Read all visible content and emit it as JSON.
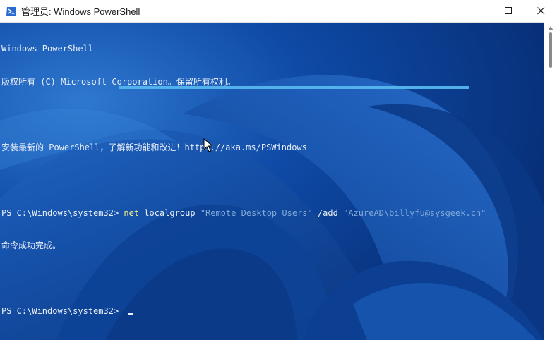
{
  "window": {
    "title": "管理员: Windows PowerShell",
    "accent": "#0b3e8e",
    "controls": [
      "minimize",
      "maximize",
      "close"
    ]
  },
  "console": {
    "banner_title": "Windows PowerShell",
    "copyright": "版权所有 (C) Microsoft Corporation。保留所有权利。",
    "install_tip": "安装最新的 PowerShell，了解新功能和改进！https://aka.ms/PSWindows",
    "prompt1": "PS C:\\Windows\\system32> ",
    "command": {
      "keyword": "net",
      "args": " localgroup ",
      "group": "\"Remote Desktop Users\"",
      "switch": " /add ",
      "user": "\"AzureAD\\billyfu@sysgeek.cn\""
    },
    "result": "命令成功完成。",
    "prompt2": "PS C:\\Windows\\system32> "
  },
  "icons": {
    "app": "powershell-icon",
    "minimize": "minimize-icon",
    "maximize": "maximize-icon",
    "close": "close-icon",
    "pointer": "mouse-pointer-icon"
  }
}
